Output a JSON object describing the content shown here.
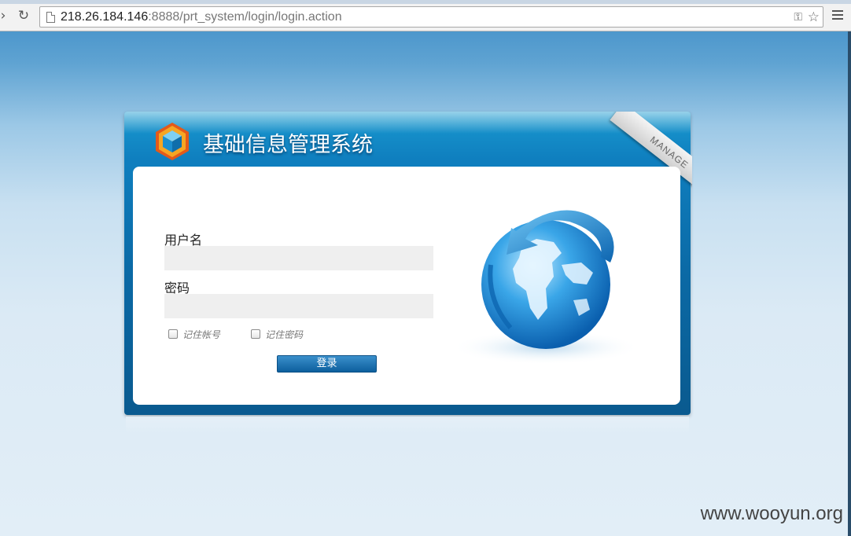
{
  "browser": {
    "url_host": "218.26.184.146",
    "url_rest": ":8888/prt_system/login/login.action"
  },
  "panel": {
    "system_title": "基础信息管理系统",
    "ribbon_text": "MANAGE"
  },
  "form": {
    "username_label": "用户名",
    "username_value": "",
    "password_label": "密码",
    "password_value": "",
    "remember_account_label": "记住帐号",
    "remember_password_label": "记住密码",
    "login_button": "登录"
  },
  "watermark": "www.wooyun.org",
  "colors": {
    "panel_blue": "#0f7fbf",
    "button_blue": "#0d5f9d",
    "field_gray": "#efefef"
  }
}
